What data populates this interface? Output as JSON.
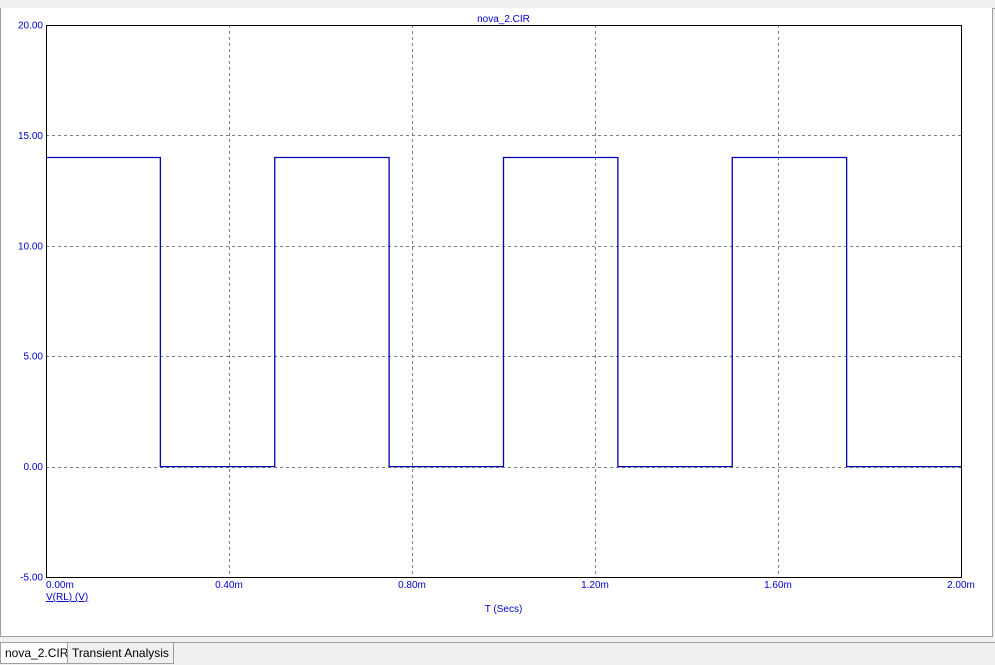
{
  "window": {
    "tabs": [
      {
        "label": "nova_2.CIR",
        "active": true
      },
      {
        "label": "Transient Analysis",
        "active": false
      }
    ]
  },
  "colors": {
    "trace": "#0000b4",
    "axis_text": "#0000d0",
    "grid": "#808080",
    "frame": "#000000"
  },
  "chart_data": {
    "type": "line",
    "title": "nova_2.CIR",
    "xlabel": "T (Secs)",
    "ylabel": "",
    "xlim": [
      0,
      0.002
    ],
    "ylim": [
      -5,
      20
    ],
    "x_ticks": [
      0,
      0.0004,
      0.0008,
      0.0012,
      0.0016,
      0.002
    ],
    "x_tick_labels": [
      "0.00m",
      "0.40m",
      "0.80m",
      "1.20m",
      "1.60m",
      "2.00m"
    ],
    "y_ticks": [
      -5,
      0,
      5,
      10,
      15,
      20
    ],
    "y_tick_labels": [
      "-5.00",
      "0.00",
      "5.00",
      "10.00",
      "15.00",
      "20.00"
    ],
    "grid": true,
    "legend_position": "bottom-left",
    "series": [
      {
        "name": "V(RL) (V)",
        "x": [
          0,
          0.00025,
          0.00025,
          0.0005,
          0.0005,
          0.00075,
          0.00075,
          0.001,
          0.001,
          0.00125,
          0.00125,
          0.0015,
          0.0015,
          0.00175,
          0.00175,
          0.002
        ],
        "y": [
          14,
          14,
          0,
          0,
          14,
          14,
          0,
          0,
          14,
          14,
          0,
          0,
          14,
          14,
          0,
          0
        ]
      }
    ]
  }
}
